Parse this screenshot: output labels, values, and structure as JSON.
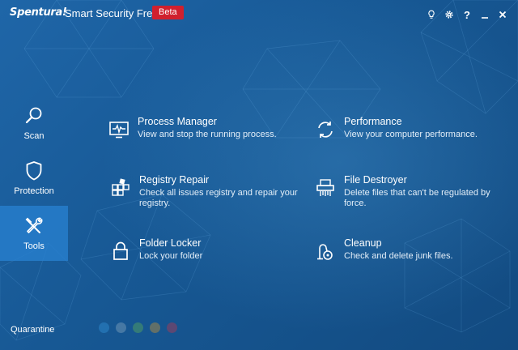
{
  "window": {
    "brand": "Spentura!",
    "title": "Smart Security Free",
    "badge": "Beta"
  },
  "titlebar": {
    "buttons": [
      {
        "name": "tips",
        "icon": "lightbulb-icon"
      },
      {
        "name": "settings",
        "icon": "gear-icon"
      },
      {
        "name": "help",
        "label": "?"
      },
      {
        "name": "minimize",
        "icon": "minimize-icon"
      },
      {
        "name": "close",
        "icon": "close-icon"
      }
    ]
  },
  "sidebar": {
    "items": [
      {
        "label": "Scan",
        "icon": "search-icon",
        "active": false
      },
      {
        "label": "Protection",
        "icon": "shield-icon",
        "active": false
      },
      {
        "label": "Tools",
        "icon": "tools-icon",
        "active": true
      }
    ],
    "bottom_label": "Quarantine"
  },
  "tools": [
    {
      "title": "Process Manager",
      "desc": "View and stop the running process.",
      "icon": "monitor-pulse-icon"
    },
    {
      "title": "Performance",
      "desc": "View your computer performance.",
      "icon": "refresh-arrows-icon"
    },
    {
      "title": "Registry Repair",
      "desc": "Check all issues registry and repair your registry.",
      "icon": "registry-blocks-icon"
    },
    {
      "title": "File Destroyer",
      "desc": "Delete files that can't be regulated by force.",
      "icon": "shredder-icon"
    },
    {
      "title": "Folder Locker",
      "desc": "Lock your folder",
      "icon": "lock-icon"
    },
    {
      "title": "Cleanup",
      "desc": "Check and delete junk files.",
      "icon": "vacuum-icon"
    }
  ],
  "colors": {
    "accent_active": "#2882d2",
    "badge": "#d0202e",
    "background": "#175894"
  }
}
